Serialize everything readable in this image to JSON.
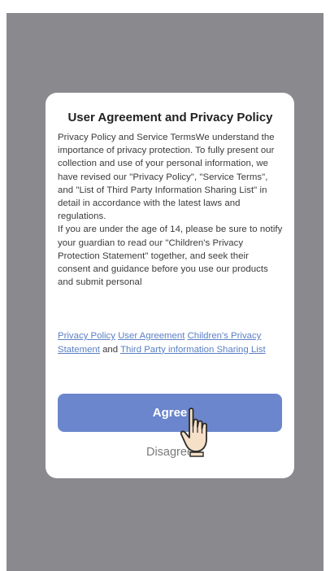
{
  "dialog": {
    "title": "User Agreement and Privacy Policy",
    "paragraph_1": "Privacy Policy and Service TermsWe understand the importance of privacy protection. To fully present our collection and use of your personal information, we have revised our \"Privacy Policy\", \"Service Terms\", and \"List of Third Party Information Sharing List\" in detail in accordance with the latest laws and regulations.",
    "paragraph_2": "If you are under the age of 14, please be sure to notify your guardian to read our \"Children's Privacy Protection Statement\" together, and seek their consent and guidance before you use our products and submit personal",
    "links": {
      "privacy_policy": "Privacy Policy",
      "user_agreement": "User Agreement",
      "childrens_privacy": "Children's Privacy Statement",
      "and_text": "and",
      "third_party": "Third Party information Sharing List"
    },
    "agree_label": "Agree",
    "disagree_label": "Disagree"
  },
  "colors": {
    "backdrop": "#8a8a8e",
    "primary_button": "#6b86cc",
    "link": "#5a7fc4"
  },
  "icons": [
    "pointing-hand-cursor-icon"
  ]
}
